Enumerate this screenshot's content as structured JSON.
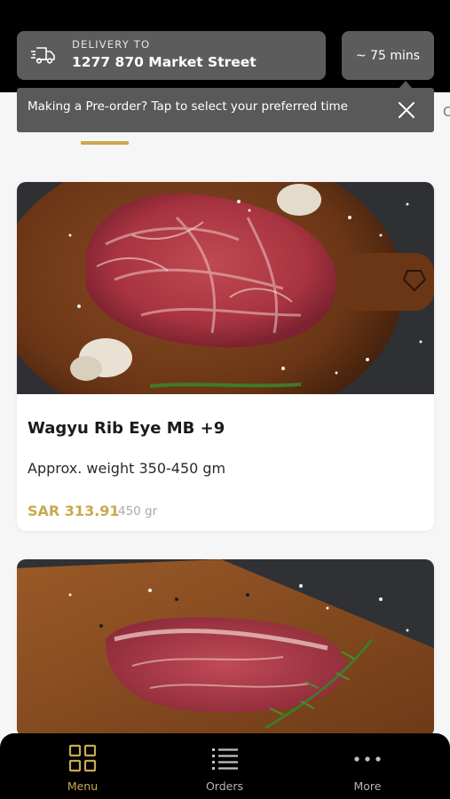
{
  "header": {
    "delivery_label": "DELIVERY TO",
    "delivery_address": "1277 870 Market Street",
    "eta": "~ 75 mins",
    "truck_icon": "delivery-truck-icon"
  },
  "tooltip": {
    "text": "Making a Pre-order? Tap to select your preferred time",
    "close_icon": "close-icon"
  },
  "tabs": {
    "partial_next_label": "C",
    "active_underline_color": "#c9a94e"
  },
  "products": [
    {
      "name": "Wagyu Rib Eye MB +9",
      "description": "Approx. weight 350-450 gm",
      "price": "SAR 313.91",
      "weight": "450 gr",
      "image": "ribeye-on-wooden-board"
    },
    {
      "name": "",
      "image": "striploin-on-wooden-board"
    }
  ],
  "bottom_nav": [
    {
      "label": "Menu",
      "icon": "grid-icon",
      "active": true
    },
    {
      "label": "Orders",
      "icon": "list-icon",
      "active": false
    },
    {
      "label": "More",
      "icon": "more-dots-icon",
      "active": false
    }
  ],
  "colors": {
    "accent": "#c9a94e",
    "header_bg": "#000000",
    "card_bg": "#5c5c5c",
    "inactive_nav": "#b5b5b5"
  }
}
